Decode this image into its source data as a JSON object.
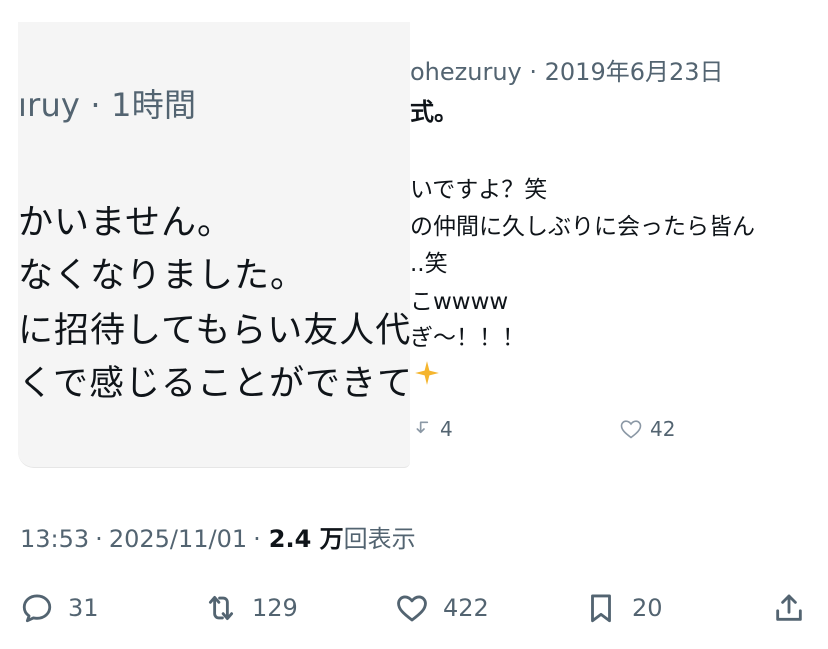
{
  "image_left": {
    "meta": "ıruy · 1時間",
    "lines": [
      "かいません。",
      "なくなりました。",
      "に招待してもらい友人代",
      "くで感じることができて"
    ]
  },
  "image_right": {
    "meta": "ohezuruy · 2019年6月23日",
    "title": "式。",
    "lines": [
      "いですよ？笑",
      "の仲間に久しぶりに会ったら皆ん",
      "..笑",
      "こwwww",
      "ぎ〜！！！"
    ],
    "retweets": "4",
    "likes": "42"
  },
  "tweet": {
    "time": "13:53",
    "date": "2025/11/01",
    "views_count": "2.4 万",
    "views_label": "回表示",
    "sep": "·"
  },
  "actions": {
    "replies": "31",
    "retweets": "129",
    "likes": "422",
    "bookmarks": "20"
  }
}
